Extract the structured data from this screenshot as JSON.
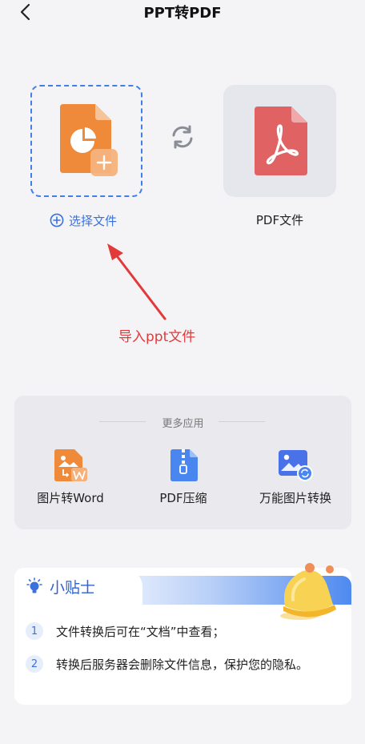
{
  "header": {
    "title": "PPT转PDF"
  },
  "convert": {
    "select_label": "选择文件",
    "target_label": "PDF文件"
  },
  "annotation": {
    "text": "导入ppt文件"
  },
  "more_apps": {
    "title": "更多应用",
    "items": [
      {
        "label": "图片转Word",
        "icon": "image-to-word-icon"
      },
      {
        "label": "PDF压缩",
        "icon": "zip-icon"
      },
      {
        "label": "万能图片转换",
        "icon": "image-convert-icon"
      }
    ]
  },
  "tips": {
    "title": "小贴士",
    "items": [
      {
        "num": "1",
        "text": "文件转换后可在“文档”中查看；"
      },
      {
        "num": "2",
        "text": "转换后服务器会删除文件信息，保护您的隐私。"
      }
    ]
  },
  "colors": {
    "accent": "#3a72dd",
    "ppt_orange": "#ee8a3a",
    "pdf_red": "#e06262",
    "annotation_red": "#e23a3a"
  }
}
